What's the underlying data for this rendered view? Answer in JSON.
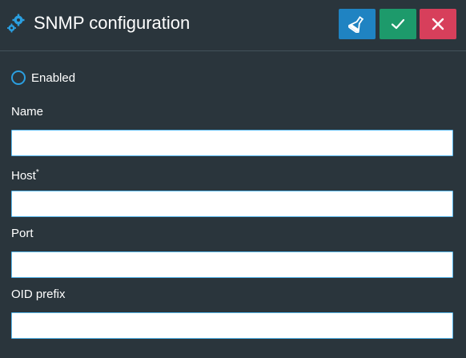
{
  "dialog": {
    "title": "SNMP configuration",
    "title_icon": "gears-icon",
    "actions": {
      "test_icon": "flask-icon",
      "save_icon": "check-icon",
      "cancel_icon": "close-icon"
    }
  },
  "enabled": {
    "label": "Enabled",
    "checked": false
  },
  "fields": {
    "name": {
      "label": "Name",
      "value": "",
      "placeholder": ""
    },
    "host": {
      "label": "Host",
      "required_marker": "*",
      "value": "",
      "placeholder": ""
    },
    "port": {
      "label": "Port",
      "value": "",
      "placeholder": ""
    },
    "oid_prefix": {
      "label": "OID prefix",
      "value": "",
      "placeholder": ""
    }
  },
  "colors": {
    "background": "#2a353c",
    "test_button": "#1f83c2",
    "save_button": "#1d9a6b",
    "cancel_button": "#d73f5b",
    "accent": "#2b9fe0"
  }
}
